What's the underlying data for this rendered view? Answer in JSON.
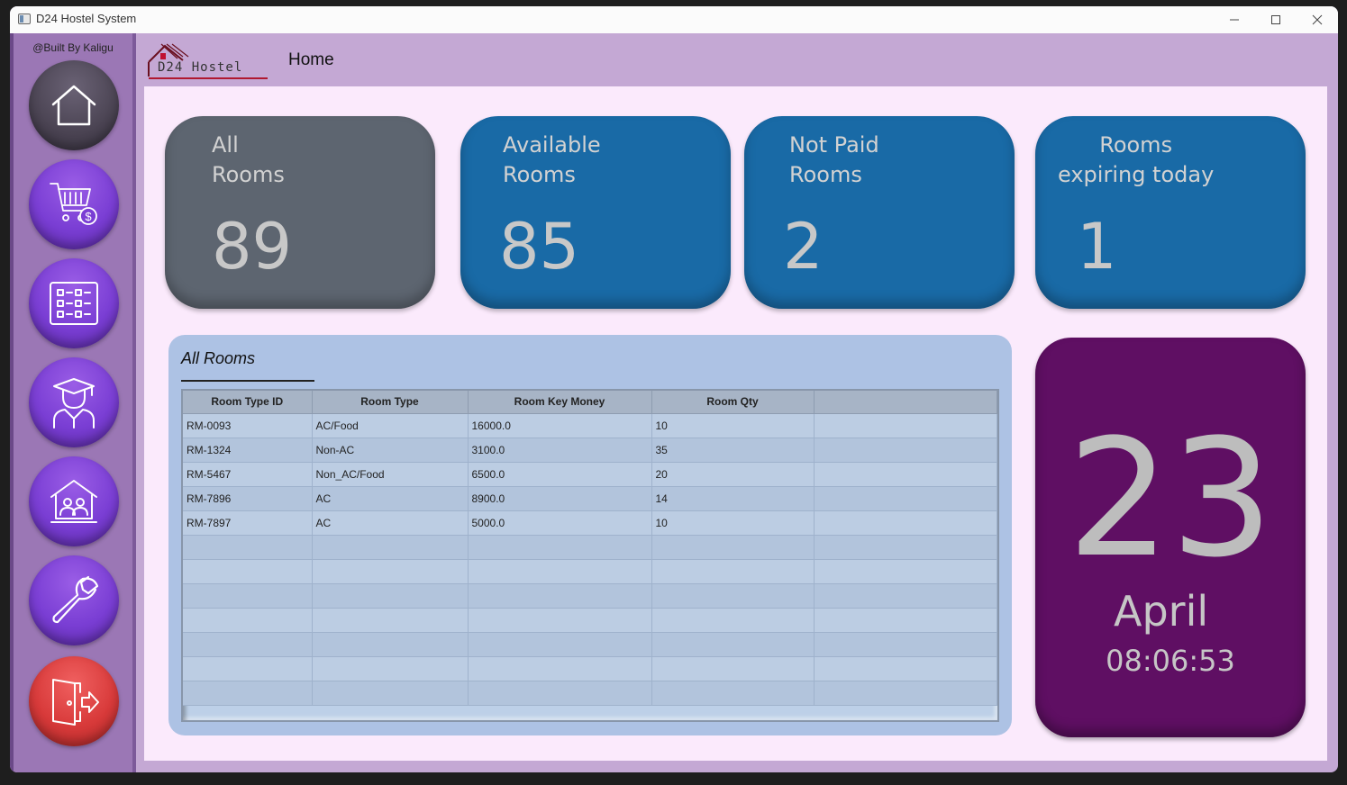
{
  "window": {
    "title": "D24 Hostel System"
  },
  "sidebar": {
    "credit": "@Built By Kaligu",
    "items": [
      {
        "name": "home",
        "icon": "home-icon"
      },
      {
        "name": "payments",
        "icon": "cart-dollar-icon"
      },
      {
        "name": "reservations",
        "icon": "checklist-icon"
      },
      {
        "name": "students",
        "icon": "student-icon"
      },
      {
        "name": "rooms",
        "icon": "room-people-icon"
      },
      {
        "name": "settings",
        "icon": "wrench-icon"
      },
      {
        "name": "logout",
        "icon": "exit-door-icon"
      }
    ]
  },
  "header": {
    "logo_text": "D24 Hostel",
    "title": "Home"
  },
  "stats": [
    {
      "label": "All\nRooms",
      "value": "89",
      "color": "#5d6570"
    },
    {
      "label": "Available\nRooms",
      "value": "85",
      "color": "#196aa6"
    },
    {
      "label": "Not Paid\nRooms",
      "value": "2",
      "color": "#196aa6"
    },
    {
      "label": "Rooms\nexpiring today",
      "value": "1",
      "color": "#196aa6"
    }
  ],
  "table": {
    "title": "All Rooms",
    "columns": [
      "Room Type ID",
      "Room Type",
      "Room Key Money",
      "Room Qty",
      ""
    ],
    "rows": [
      [
        "RM-0093",
        "AC/Food",
        "16000.0",
        "10"
      ],
      [
        "RM-1324",
        "Non-AC",
        "3100.0",
        "35"
      ],
      [
        "RM-5467",
        "Non_AC/Food",
        "6500.0",
        "20"
      ],
      [
        "RM-7896",
        "AC",
        "8900.0",
        "14"
      ],
      [
        "RM-7897",
        "AC",
        "5000.0",
        "10"
      ]
    ]
  },
  "date_card": {
    "day": "23",
    "month": "April",
    "time": "08:06:53",
    "color": "#5f0f63"
  }
}
